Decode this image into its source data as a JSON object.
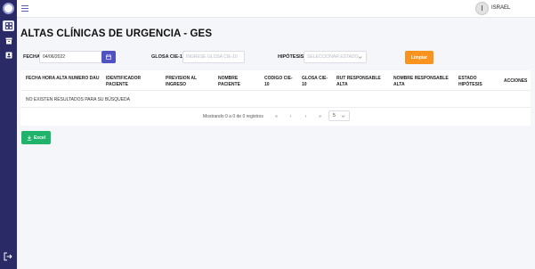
{
  "header": {
    "user_initial": "I",
    "user_name": "ISRAEL"
  },
  "page": {
    "title": "ALTAS CLÍNICAS DE URGENCIA - GES"
  },
  "filters": {
    "fecha_label": "FECHA:",
    "fecha_value": "04/06/2022",
    "glosa_label": "GLOSA CIE-10:",
    "glosa_placeholder": "INGRESE GLOSA CIE-10",
    "hipotesis_label": "HIPÓTESIS:",
    "hipotesis_placeholder": "SELECCIONAR ESTADO",
    "limpiar_label": "Limpiar"
  },
  "table": {
    "columns": [
      "FECHA HORA ALTA",
      "NUMERO DAU",
      "IDENTIFICADOR PACIENTE",
      "PREVISION AL INGRESO",
      "NOMBRE PACIENTE",
      "CODIGO CIE-10",
      "GLOSA CIE-10",
      "RUT RESPONSABLE ALTA",
      "NOMBRE RESPONSABLE ALTA",
      "ESTADO HIPÓTESIS",
      "ACCIONES"
    ],
    "empty_message": "NO EXISTEN RESULTADOS PARA SU BÚSQUEDA",
    "pagination": {
      "summary": "Mostrando 0 a 0 de 0 registros",
      "first": "«",
      "prev": "‹",
      "next": "›",
      "last": "»",
      "page_size": "5"
    }
  },
  "actions": {
    "excel_label": "Excel"
  },
  "colors": {
    "sidebar": "#2a2a66",
    "accent": "#4f52c2",
    "limpiar": "#f7931e",
    "excel": "#1fb36b"
  }
}
